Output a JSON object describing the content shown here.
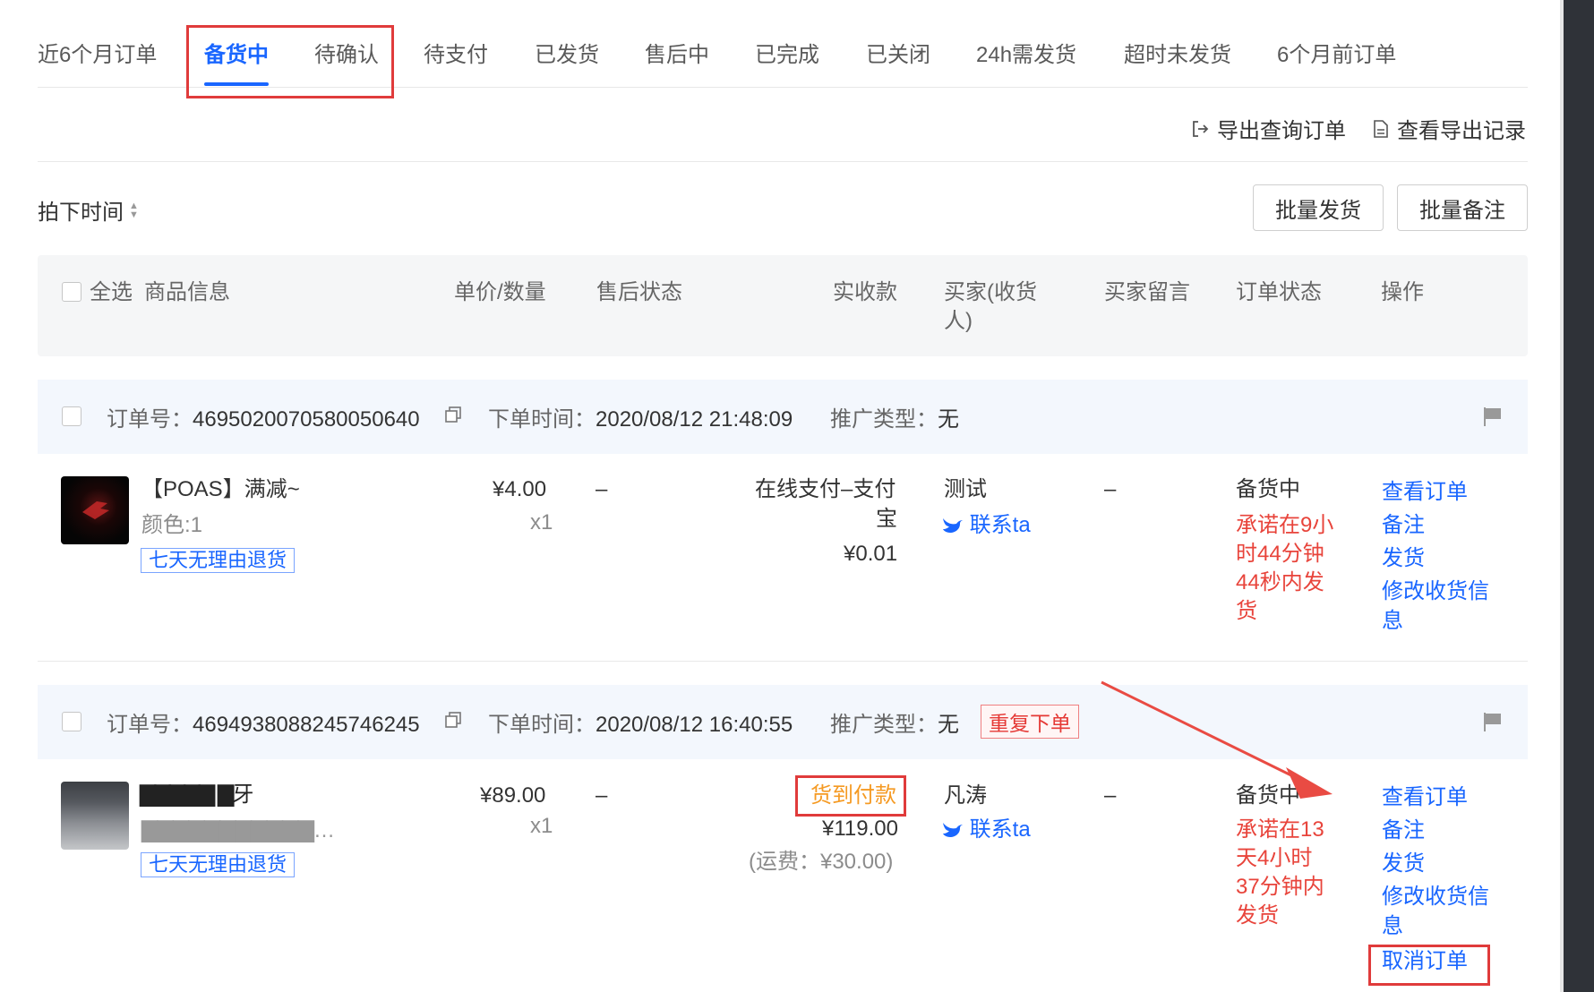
{
  "tabs": [
    {
      "label": "近6个月订单",
      "active": false
    },
    {
      "label": "备货中",
      "active": true
    },
    {
      "label": "待确认",
      "active": false
    },
    {
      "label": "待支付",
      "active": false
    },
    {
      "label": "已发货",
      "active": false
    },
    {
      "label": "售后中",
      "active": false
    },
    {
      "label": "已完成",
      "active": false
    },
    {
      "label": "已关闭",
      "active": false
    },
    {
      "label": "24h需发货",
      "active": false
    },
    {
      "label": "超时未发货",
      "active": false
    },
    {
      "label": "6个月前订单",
      "active": false
    }
  ],
  "toolbar": {
    "export_label": "导出查询订单",
    "export_icon": "export-icon",
    "records_label": "查看导出记录",
    "records_icon": "document-icon"
  },
  "sort": {
    "label": "拍下时间",
    "icon": "sort-icon"
  },
  "batch": {
    "ship_label": "批量发货",
    "note_label": "批量备注"
  },
  "table_header": {
    "select_all": "全选",
    "columns": [
      "商品信息",
      "单价/数量",
      "售后状态",
      "实收款",
      "买家(收货人)",
      "买家留言",
      "订单状态",
      "操作"
    ],
    "buyer_col_line1": "买家(收货",
    "buyer_col_line2": "人)"
  },
  "labels": {
    "order_no": "订单号：",
    "order_time": "下单时间：",
    "promo_type": "推广类型：",
    "contact": "联系ta",
    "dash": "–"
  },
  "orders": [
    {
      "order_no": "4695020070580050640",
      "order_time": "2020/08/12 21:48:09",
      "promo_type": "无",
      "product_title": "【POAS】满减~",
      "product_spec": "颜色:1",
      "return_tag": "七天无理由退货",
      "price": "¥4.00",
      "qty": "x1",
      "after_sale": "–",
      "payment_line1": "在线支付–支付",
      "payment_line2": "宝",
      "amount": "¥0.01",
      "buyer": "测试",
      "message": "–",
      "status": "备货中",
      "promise_lines": [
        "承诺在9小",
        "时44分钟",
        "44秒内发",
        "货"
      ],
      "actions": [
        "查看订单",
        "备注",
        "发货",
        "修改收货信",
        "息"
      ]
    },
    {
      "order_no": "4694938088245746245",
      "order_time": "2020/08/12 16:40:55",
      "promo_type": "无",
      "dup_tag": "重复下单",
      "product_title": "▇▇▇▇▇ ▇牙",
      "product_spec": "▇▇▇▇▇▇▇▇▇▇▇…",
      "return_tag": "七天无理由退货",
      "price": "¥89.00",
      "qty": "x1",
      "after_sale": "–",
      "payment_tag": "货到付款",
      "amount": "¥119.00",
      "shipping_fee": "(运费：¥30.00)",
      "buyer": "凡涛",
      "message": "–",
      "status": "备货中",
      "promise_lines": [
        "承诺在13",
        "天4小时",
        "37分钟内",
        "发货"
      ],
      "actions": [
        "查看订单",
        "备注",
        "发货",
        "修改收货信",
        "息",
        "取消订单"
      ]
    }
  ],
  "colors": {
    "accent": "#1966ff",
    "highlight_box": "#e03b3b",
    "warning": "#f59a23",
    "promise": "#e8443b"
  }
}
